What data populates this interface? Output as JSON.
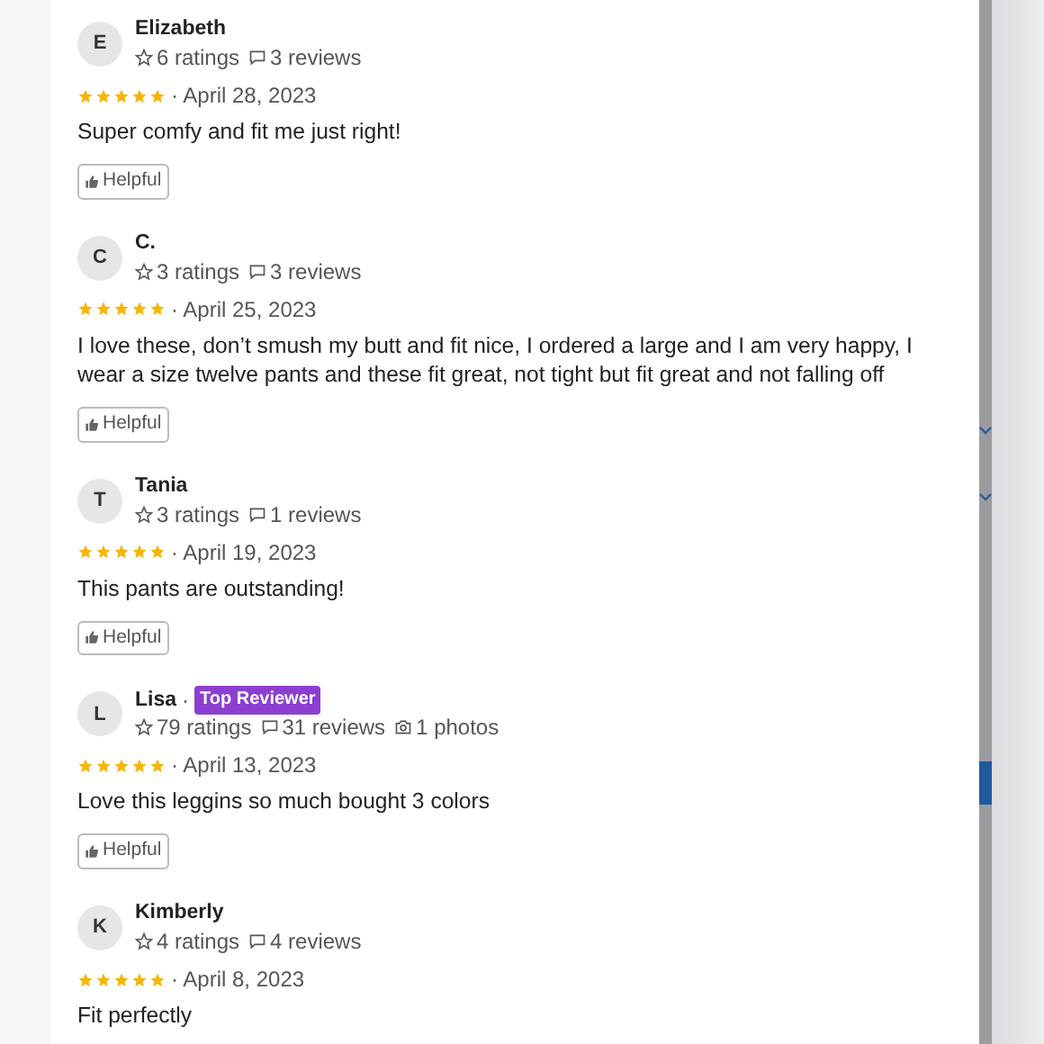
{
  "reviews": [
    {
      "initial": "E",
      "name": "Elizabeth",
      "stats": [
        {
          "kind": "ratings",
          "text": "6 ratings"
        },
        {
          "kind": "reviews",
          "text": "3 reviews"
        }
      ],
      "stars": 5,
      "date": "· April 28, 2023",
      "text": "Super comfy and fit me just right!",
      "helpful": "Helpful"
    },
    {
      "initial": "C",
      "name": "C.",
      "stats": [
        {
          "kind": "ratings",
          "text": "3 ratings"
        },
        {
          "kind": "reviews",
          "text": "3 reviews"
        }
      ],
      "stars": 5,
      "date": "· April 25, 2023",
      "text": "I love these, don’t smush my butt and fit nice, I ordered a large and I am very happy, I wear a size twelve pants and these fit great, not tight but fit great and not falling off",
      "helpful": "Helpful"
    },
    {
      "initial": "T",
      "name": "Tania",
      "stats": [
        {
          "kind": "ratings",
          "text": "3 ratings"
        },
        {
          "kind": "reviews",
          "text": "1 reviews"
        }
      ],
      "stars": 5,
      "date": "· April 19, 2023",
      "text": "This pants are outstanding!",
      "helpful": "Helpful"
    },
    {
      "initial": "L",
      "name": "Lisa",
      "separator": "·",
      "badge": "Top Reviewer",
      "stats": [
        {
          "kind": "ratings",
          "text": "79 ratings"
        },
        {
          "kind": "reviews",
          "text": "31 reviews"
        },
        {
          "kind": "photos",
          "text": "1 photos"
        }
      ],
      "stars": 5,
      "date": "· April 13, 2023",
      "text": "Love this leggins so much bought 3 colors",
      "helpful": "Helpful"
    },
    {
      "initial": "K",
      "name": "Kimberly",
      "stats": [
        {
          "kind": "ratings",
          "text": "4 ratings"
        },
        {
          "kind": "reviews",
          "text": "4 reviews"
        }
      ],
      "stars": 5,
      "date": "· April 8, 2023",
      "text": "Fit perfectly"
    }
  ]
}
